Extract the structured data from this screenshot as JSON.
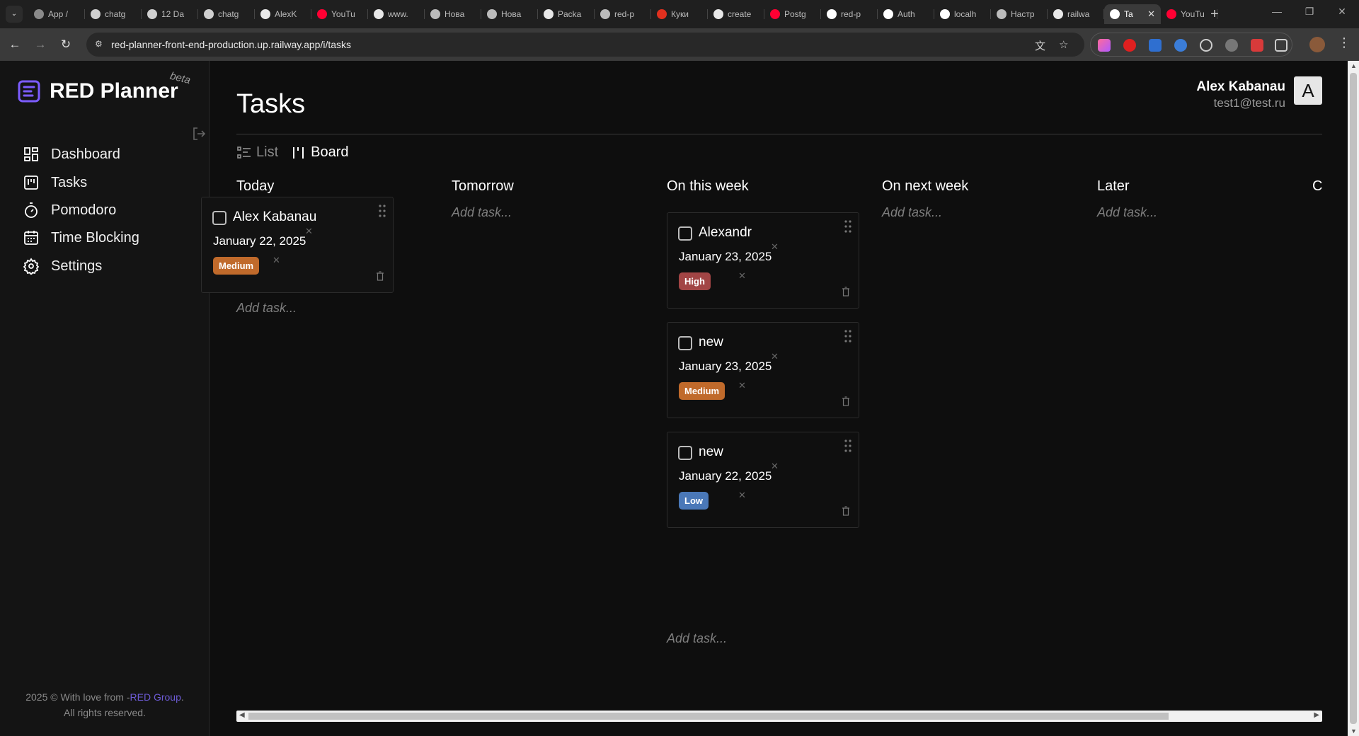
{
  "browser": {
    "tabs": [
      {
        "title": "App /",
        "color": "#8a8a8a"
      },
      {
        "title": "chatg",
        "color": "#d0d0d0"
      },
      {
        "title": "12 Da",
        "color": "#d0d0d0"
      },
      {
        "title": "chatg",
        "color": "#d0d0d0"
      },
      {
        "title": "AlexK",
        "color": "#e8e8e8"
      },
      {
        "title": "YouTu",
        "color": "#ff0033"
      },
      {
        "title": "www.",
        "color": "#e8e8e8"
      },
      {
        "title": "Нова",
        "color": "#bbbbbb"
      },
      {
        "title": "Нова",
        "color": "#bbbbbb"
      },
      {
        "title": "Packa",
        "color": "#e8e8e8"
      },
      {
        "title": "red-p",
        "color": "#bbbbbb"
      },
      {
        "title": "Куки",
        "color": "#e0301e"
      },
      {
        "title": "create",
        "color": "#e8e8e8"
      },
      {
        "title": "Postg",
        "color": "#ff0033"
      },
      {
        "title": "red-p",
        "color": "#ffffff"
      },
      {
        "title": "Auth",
        "color": "#ffffff"
      },
      {
        "title": "localh",
        "color": "#ffffff"
      },
      {
        "title": "Настр",
        "color": "#bbbbbb"
      },
      {
        "title": "railwa",
        "color": "#e8e8e8"
      },
      {
        "title": "Ta",
        "color": "#ffffff",
        "active": true
      },
      {
        "title": "YouTu",
        "color": "#ff0033"
      }
    ],
    "url": "red-planner-front-end-production.up.railway.app/i/tasks"
  },
  "sidebar": {
    "logo": "RED Planner",
    "beta": "beta",
    "items": [
      {
        "label": "Dashboard",
        "icon": "dashboard-icon"
      },
      {
        "label": "Tasks",
        "icon": "kanban-icon"
      },
      {
        "label": "Pomodoro",
        "icon": "timer-icon"
      },
      {
        "label": "Time Blocking",
        "icon": "calendar-icon"
      },
      {
        "label": "Settings",
        "icon": "gear-icon"
      }
    ],
    "footer_line1": "2025 © With love from -",
    "footer_link": "RED Group",
    "footer_period": ".",
    "footer_line2": "All rights reserved."
  },
  "header": {
    "title": "Tasks",
    "user_name": "Alex Kabanau",
    "user_email": "test1@test.ru",
    "avatar_letter": "A"
  },
  "view_switch": {
    "list": "List",
    "board": "Board"
  },
  "board": {
    "add_task": "Add task...",
    "columns": [
      {
        "title": "Today"
      },
      {
        "title": "Tomorrow"
      },
      {
        "title": "On this week"
      },
      {
        "title": "On next week"
      },
      {
        "title": "Later"
      },
      {
        "title": "C"
      }
    ],
    "cards": [
      {
        "name": "Alex Kabanau",
        "date": "January 22, 2025",
        "priority": "Medium"
      },
      {
        "name": "Alexandr",
        "date": "January 23, 2025",
        "priority": "High"
      },
      {
        "name": "new",
        "date": "January 23, 2025",
        "priority": "Medium"
      },
      {
        "name": "new",
        "date": "January 22, 2025",
        "priority": "Low"
      }
    ]
  },
  "colors": {
    "accent": "#7c5cff",
    "priority_medium": "#c06a2b",
    "priority_high": "#a24545",
    "priority_low": "#4a78b8"
  }
}
